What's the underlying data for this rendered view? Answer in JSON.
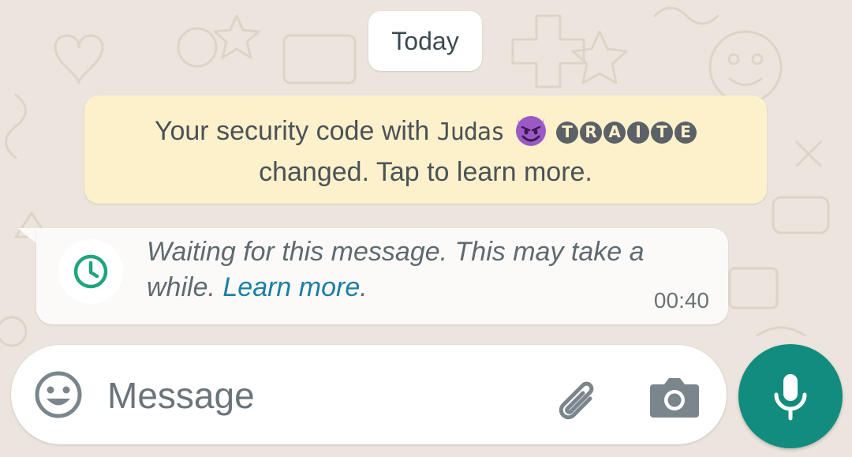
{
  "date_chip": {
    "label": "Today"
  },
  "security_notice": {
    "prefix": "Your security code with ",
    "contact_name": "Judas",
    "contact_emoji": "smiling-imp",
    "contact_suffix_letters": [
      "T",
      "R",
      "A",
      "I",
      "T",
      "E"
    ],
    "line2": "changed. Tap to learn more."
  },
  "waiting_message": {
    "text": "Waiting for this message. This may take a while. ",
    "link_text": "Learn more",
    "trailing": ".",
    "time": "00:40",
    "icon": "clock-icon"
  },
  "composer": {
    "placeholder": "Message",
    "emoji_icon": "emoji-icon",
    "attach_icon": "paperclip-icon",
    "camera_icon": "camera-icon"
  },
  "mic_button": {
    "icon": "microphone-icon"
  },
  "colors": {
    "background": "#ece5dd",
    "notice": "#fdf1cc",
    "accent_green": "#128c7e",
    "link_blue": "#1a7fa4",
    "clock_green": "#1fa57e"
  }
}
